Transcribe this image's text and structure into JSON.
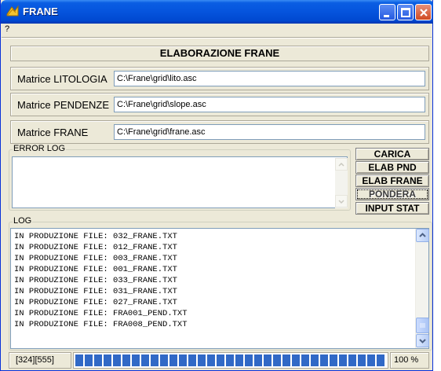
{
  "window": {
    "title": "FRANE"
  },
  "menu": {
    "help": "?"
  },
  "header": {
    "title": "ELABORAZIONE FRANE"
  },
  "inputs": {
    "litologia": {
      "label": "Matrice LITOLOGIA",
      "value": "C:\\Frane\\grid\\lito.asc"
    },
    "pendenze": {
      "label": "Matrice PENDENZE",
      "value": "C:\\Frane\\grid\\slope.asc"
    },
    "frane": {
      "label": "Matrice FRANE",
      "value": "C:\\Frane\\grid\\frane.asc"
    }
  },
  "error_log": {
    "legend": "ERROR LOG",
    "content": ""
  },
  "buttons": {
    "carica": "CARICA",
    "elab_pnd": "ELAB PND",
    "elab_frane": "ELAB FRANE",
    "pondera": "PONDERA",
    "input_stat": "INPUT STAT"
  },
  "log": {
    "legend": "LOG",
    "lines": [
      "IN PRODUZIONE FILE: 032_FRANE.TXT",
      "IN PRODUZIONE FILE: 012_FRANE.TXT",
      "IN PRODUZIONE FILE: 003_FRANE.TXT",
      "IN PRODUZIONE FILE: 001_FRANE.TXT",
      "IN PRODUZIONE FILE: 033_FRANE.TXT",
      "IN PRODUZIONE FILE: 031_FRANE.TXT",
      "IN PRODUZIONE FILE: 027_FRANE.TXT",
      "IN PRODUZIONE FILE: FRA001_PEND.TXT",
      "IN PRODUZIONE FILE: FRA008_PEND.TXT"
    ]
  },
  "status": {
    "dims": "[324][555]",
    "progress_percent": 100,
    "progress_label": "100 %"
  },
  "colors": {
    "title_bar": "#0554dd",
    "progress": "#3169c6",
    "window_bg": "#ece9d8"
  }
}
